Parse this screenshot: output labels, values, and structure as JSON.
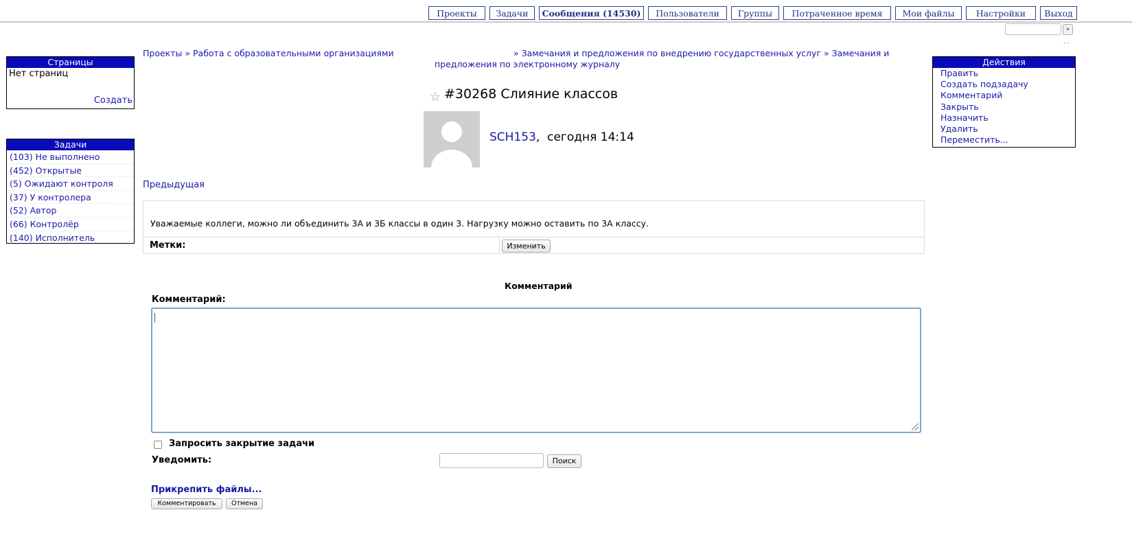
{
  "nav": {
    "tabs": [
      {
        "label": "Проекты"
      },
      {
        "label": "Задачи"
      },
      {
        "label": "Сообщения (14530)",
        "active": true
      },
      {
        "label": "Пользователи"
      },
      {
        "label": "Группы"
      },
      {
        "label": "Потраченное время"
      },
      {
        "label": "Мои файлы"
      },
      {
        "label": "Настройки"
      },
      {
        "label": "Выход"
      }
    ],
    "search_button": "»"
  },
  "pages_panel": {
    "title": "Страницы",
    "empty_text": "Нет страниц",
    "create_link": "Создать"
  },
  "tasks_panel": {
    "title": "Задачи",
    "items": [
      {
        "label": "(103) Не выполнено"
      },
      {
        "label": "(452) Открытые"
      },
      {
        "label": "(5) Ожидают контроля"
      },
      {
        "label": "(37) У контролера"
      },
      {
        "label": "(52) Автор"
      },
      {
        "label": "(66) Контролёр"
      },
      {
        "label": "(140) Исполнитель"
      }
    ]
  },
  "actions_panel": {
    "title": "Действия",
    "items": [
      {
        "label": "Править"
      },
      {
        "label": "Создать подзадачу"
      },
      {
        "label": "Комментарий"
      },
      {
        "label": "Закрыть"
      },
      {
        "label": "Назначить"
      },
      {
        "label": "Удалить"
      },
      {
        "label": "Переместить..."
      }
    ]
  },
  "breadcrumb": {
    "item1": "Проекты",
    "sep": "»",
    "item2": "Работа с образовательными организациями",
    "item3": "Замечания и предложения по внедрению государственных услуг",
    "item4_part1": "Замечания и",
    "item4_part2": "предложения по электронному журналу"
  },
  "task": {
    "title": "#30268 Слияние классов",
    "author": "SCH153",
    "date": "сегодня 14:14",
    "prev_link": "Предыдущая",
    "body": "Уважаемые коллеги, можно ли объединить 3А и 3Б классы в один 3. Нагрузку можно оставить по 3А классу.",
    "tags_label": "Метки:",
    "change_button": "Изменить"
  },
  "comment_form": {
    "heading": "Комментарий",
    "label": "Комментарий:",
    "request_close": "Запросить закрытие задачи",
    "notify_label": "Уведомить:",
    "search_button": "Поиск",
    "attach_link": "Прикрепить файлы...",
    "submit_button": "Комментировать",
    "cancel_button": "Отмена"
  }
}
